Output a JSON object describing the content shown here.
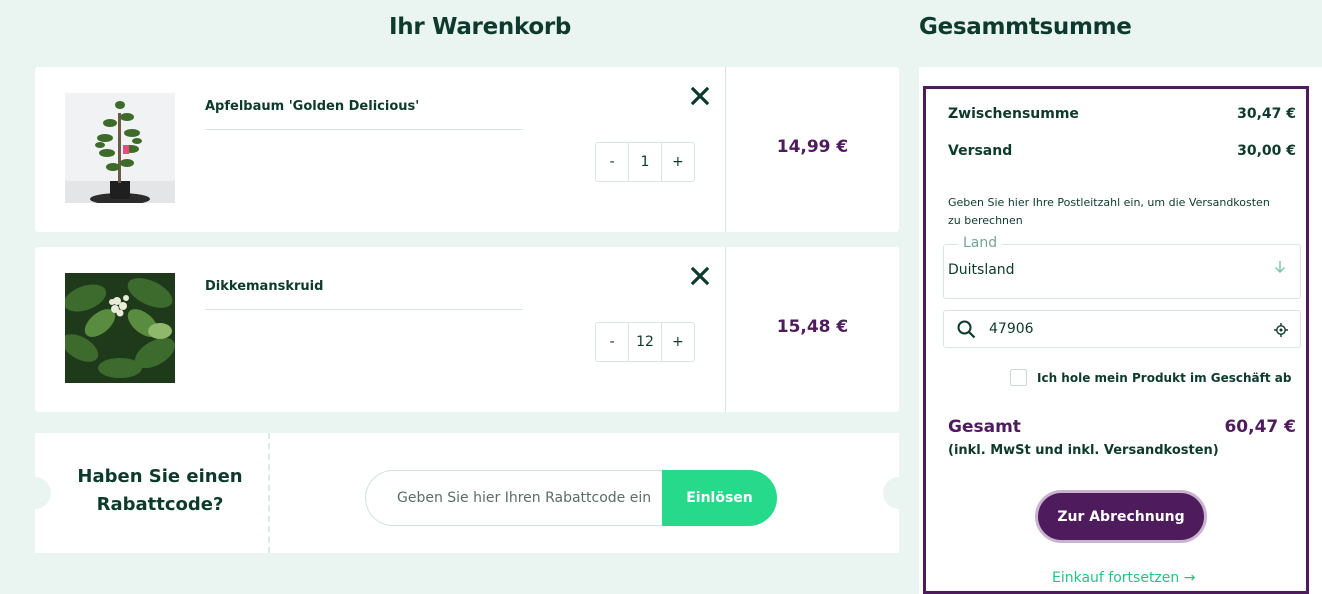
{
  "cart": {
    "title": "Ihr Warenkorb",
    "items": [
      {
        "name": "Apfelbaum 'Golden Delicious'",
        "quantity": "1",
        "price": "14,99 €",
        "remove_icon": "close-icon",
        "minus": "-",
        "plus": "+"
      },
      {
        "name": "Dikkemanskruid",
        "quantity": "12",
        "price": "15,48 €",
        "remove_icon": "close-icon",
        "minus": "-",
        "plus": "+"
      }
    ]
  },
  "coupon": {
    "title": "Haben Sie einen Rabattcode?",
    "placeholder": "Geben Sie hier Ihren Rabattcode ein",
    "button": "Einlösen"
  },
  "summary": {
    "title": "Gesammtsumme",
    "subtotal_label": "Zwischensumme",
    "subtotal_value": "30,47 €",
    "shipping_label": "Versand",
    "shipping_value": "30,00 €",
    "hint": "Geben Sie hier Ihre Postleitzahl ein, um die Versandkosten zu berechnen",
    "country_label": "Land",
    "country_value": "Duitsland",
    "zip_value": "47906",
    "pickup_label": "Ich hole mein Produkt im Geschäft ab",
    "total_label": "Gesamt",
    "total_value": "60,47 €",
    "total_note": "(inkl. MwSt und inkl. Versandkosten)",
    "checkout_button": "Zur Abrechnung",
    "continue_link": "Einkauf fortsetzen →"
  },
  "colors": {
    "background": "#eaf5f1",
    "primary_text": "#0d3a2c",
    "accent_purple": "#4e1b5c",
    "accent_green": "#27d98a"
  }
}
